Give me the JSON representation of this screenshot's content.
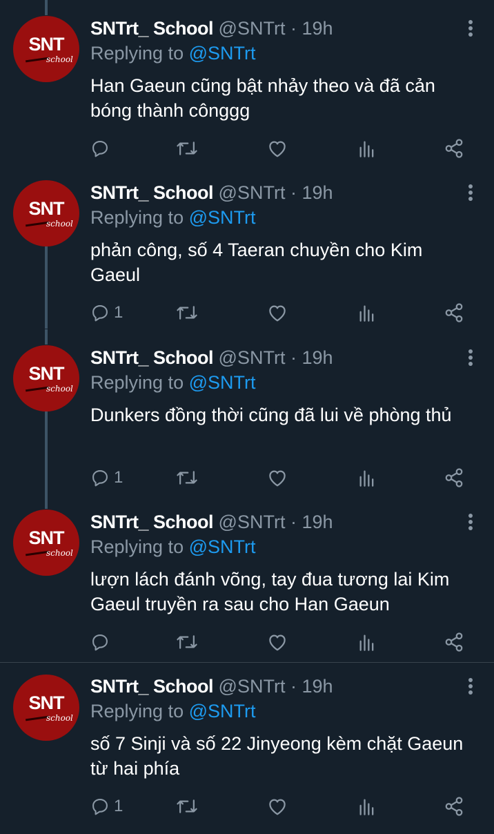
{
  "tweets": [
    {
      "name": "SNTrt_ School",
      "handle": "@SNTrt",
      "dot": "·",
      "time": "19h",
      "replying_prefix": "Replying to ",
      "replying_handle": "@SNTrt",
      "text": "Han Gaeun cũng bật nhảy theo và đã cản bóng thành cônggg",
      "reply_count": "",
      "avatar_text": "SNT",
      "avatar_sub": "school"
    },
    {
      "name": "SNTrt_ School",
      "handle": "@SNTrt",
      "dot": "·",
      "time": "19h",
      "replying_prefix": "Replying to ",
      "replying_handle": "@SNTrt",
      "text": "phản công, số 4 Taeran chuyền cho Kim Gaeul",
      "reply_count": "1",
      "avatar_text": "SNT",
      "avatar_sub": "school"
    },
    {
      "name": "SNTrt_ School",
      "handle": "@SNTrt",
      "dot": "·",
      "time": "19h",
      "replying_prefix": "Replying to ",
      "replying_handle": "@SNTrt",
      "text": "Dunkers đồng thời cũng đã lui về phòng thủ",
      "reply_count": "1",
      "avatar_text": "SNT",
      "avatar_sub": "school"
    },
    {
      "name": "SNTrt_ School",
      "handle": "@SNTrt",
      "dot": "·",
      "time": "19h",
      "replying_prefix": "Replying to ",
      "replying_handle": "@SNTrt",
      "text": "lượn lách đánh võng, tay đua tương lai Kim Gaeul truyền ra sau cho Han Gaeun",
      "reply_count": "",
      "avatar_text": "SNT",
      "avatar_sub": "school"
    },
    {
      "name": "SNTrt_ School",
      "handle": "@SNTrt",
      "dot": "·",
      "time": "19h",
      "replying_prefix": "Replying to ",
      "replying_handle": "@SNTrt",
      "text": "số 7 Sinji và số 22 Jinyeong kèm chặt Gaeun từ hai phía",
      "reply_count": "1",
      "avatar_text": "SNT",
      "avatar_sub": "school"
    }
  ],
  "icons": {
    "reply": "reply-icon",
    "retweet": "retweet-icon",
    "like": "heart-icon",
    "analytics": "analytics-icon",
    "share": "share-icon",
    "menu": "more-vertical-icon"
  },
  "colors": {
    "background": "#15202b",
    "muted": "#8b98a5",
    "link": "#1d9bf0",
    "avatar": "#9a0f0f",
    "thread_line": "#3d5466"
  }
}
